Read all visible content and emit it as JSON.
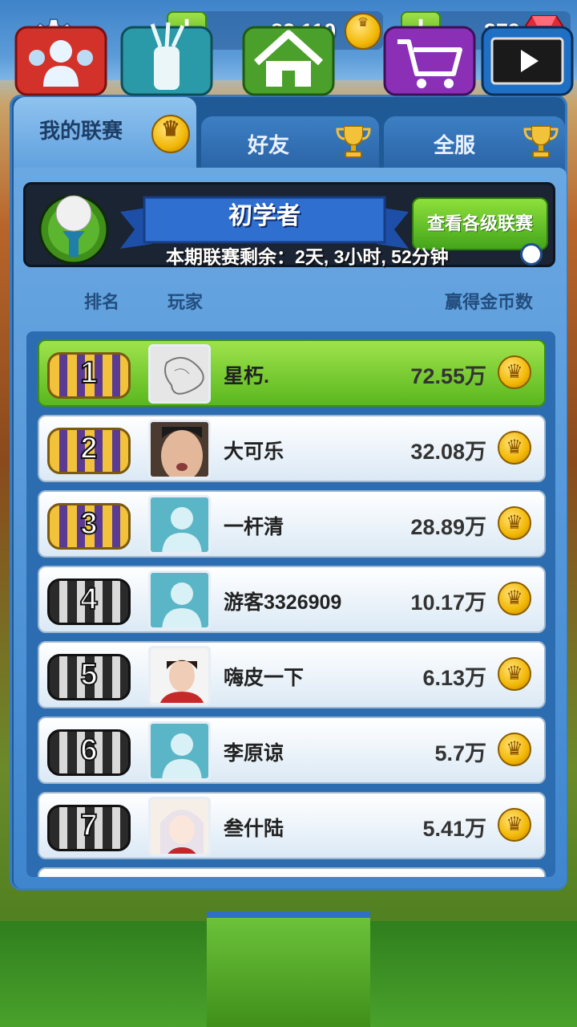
{
  "topbar": {
    "coins": "82,110",
    "gems": "379",
    "colors": {
      "coin": "#f2b705",
      "gem": "#e02a3a",
      "plus": "#4fae17"
    }
  },
  "tabs": [
    {
      "label": "我的联赛",
      "active": true,
      "icon": "crown-coin-icon"
    },
    {
      "label": "好友",
      "active": false,
      "icon": "trophy-icon"
    },
    {
      "label": "全服",
      "active": false,
      "icon": "trophy-icon"
    }
  ],
  "league": {
    "title": "初学者",
    "view_button": "查看各级联赛",
    "remaining": "本期联赛剩余：2天, 3小时, 52分钟"
  },
  "columns": {
    "rank": "排名",
    "player": "玩家",
    "earned": "赢得金币数"
  },
  "rows": [
    {
      "rank": "1",
      "name": "星朽.",
      "value": "72.55万",
      "chest": "gold",
      "avatar": "sketch",
      "highlight": true
    },
    {
      "rank": "2",
      "name": "大可乐",
      "value": "32.08万",
      "chest": "gold",
      "avatar": "photo",
      "highlight": false
    },
    {
      "rank": "3",
      "name": "一杆清",
      "value": "28.89万",
      "chest": "gold",
      "avatar": "default",
      "highlight": false
    },
    {
      "rank": "4",
      "name": "游客3326909",
      "value": "10.17万",
      "chest": "silver",
      "avatar": "default",
      "highlight": false
    },
    {
      "rank": "5",
      "name": "嗨皮一下",
      "value": "6.13万",
      "chest": "silver",
      "avatar": "photo",
      "highlight": false
    },
    {
      "rank": "6",
      "name": "李原谅",
      "value": "5.7万",
      "chest": "silver",
      "avatar": "default",
      "highlight": false
    },
    {
      "rank": "7",
      "name": "叁什陆",
      "value": "5.41万",
      "chest": "silver",
      "avatar": "anime",
      "highlight": false
    }
  ],
  "nav": [
    {
      "icon": "social-icon",
      "active": false
    },
    {
      "icon": "golf-bag-icon",
      "active": false
    },
    {
      "icon": "home-icon",
      "active": true
    },
    {
      "icon": "shop-cart-icon",
      "active": false
    },
    {
      "icon": "replay-tv-icon",
      "active": false
    }
  ]
}
